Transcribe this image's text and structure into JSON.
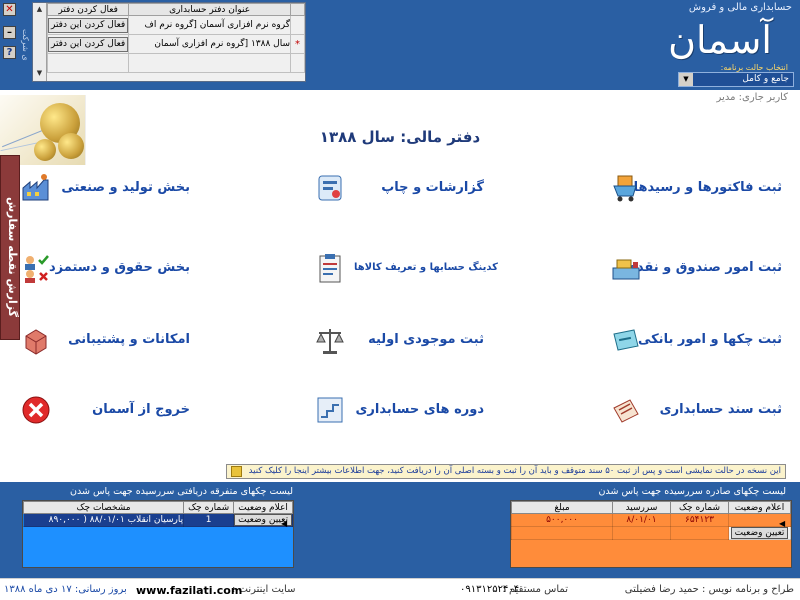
{
  "header": {
    "app_subtitle": "حسابداری مالی و فروش",
    "logo_text": "آسمان",
    "mode_label": "انتخاب حالت برنامه:",
    "mode_value": "جامع و کامل",
    "vertical_label": "ی شرکت"
  },
  "ledger_table": {
    "col_title": "عنوان دفتر حسابداری",
    "col_action": "فعال کردن دفتر",
    "rows": [
      {
        "marker": "",
        "title": "گروه نرم افزاری آسمان [گروه نرم اف",
        "action": "فعال کردن این دفتر"
      },
      {
        "marker": "*",
        "title": "سال ۱۳۸۸ [گروه نرم افزاری آسمان",
        "action": "فعال کردن این دفتر"
      }
    ]
  },
  "current_user": "کاربر جاری: مدیر",
  "fiscal_title": "دفتر مالی: سال ۱۳۸۸",
  "side_tab": "گزارش نقطه سفارش",
  "menu": {
    "invoices": "ثبت فاکتورها و رسیدها",
    "reports": "گزارشات و چاپ",
    "production": "بخش تولید و صنعتی",
    "cash": "ثبت امور صندوق و نقدی",
    "coding": "کدینگ حسابها و تعریف  کالاها",
    "payroll": "بخش حقوق و دستمزد",
    "cheques": "ثبت چکها و امور بانکی",
    "inventory": "ثبت موجودی اولیه",
    "support": "امکانات و پشتیبانی",
    "vouchers": "ثبت سند حسابداری",
    "periods": "دوره های حسابداری",
    "exit": "خروج از آسمان"
  },
  "info_banner": "این نسخه در حالت نمایشی است و پس از ثبت ۵۰ سند متوقف و باید آن را ثبت و بسته اصلی آن را دریافت کنید، جهت اطلاعات بیشتر اینجا را کلیک کنید",
  "received_cheques": {
    "title": "لیست چکهای متفرقه دریافتی سررسیده جهت پاس شدن",
    "columns": [
      "اعلام وضعیت",
      "شماره چک",
      "مشخصات چک"
    ],
    "rows": [
      {
        "status": "تعیین وضعیت",
        "number": "1",
        "details": "پارسیان انقلاب ۸۸/۰۱/۰۱ ( ۸۹۰,۰۰۰"
      }
    ]
  },
  "issued_cheques": {
    "title": "لیست چکهای صادره سررسیده جهت پاس شدن",
    "columns": [
      "اعلام وضعیت",
      "شماره چک",
      "سررسید",
      "مبلغ"
    ],
    "rows": [
      {
        "status": "",
        "number": "۶۵۴۱۲۳",
        "due": "۸/۰۱/۰۱",
        "amount": "۵۰۰,۰۰۰"
      },
      {
        "status": "تعیین وضعیت",
        "number": "",
        "due": "",
        "amount": ""
      }
    ]
  },
  "footer": {
    "designer": "طراح و برنامه نویس : حمید رضا فضیلتی",
    "contact_label": "تماس مستقیم :",
    "phone": "۰۹۱۳۱۲۵۲۴۰۴",
    "website_label": "سایت اینترنت :",
    "website": "www.fazilati.com",
    "update": "بروز رسانی: ۱۷ دی ماه ۱۳۸۸"
  },
  "colors": {
    "header_bg": "#2a5fa3",
    "menu_text": "#1a49a6",
    "side_tab": "#8b3a3a",
    "panel_blue": "#1e90ff",
    "panel_orange": "#ff8c3a"
  }
}
